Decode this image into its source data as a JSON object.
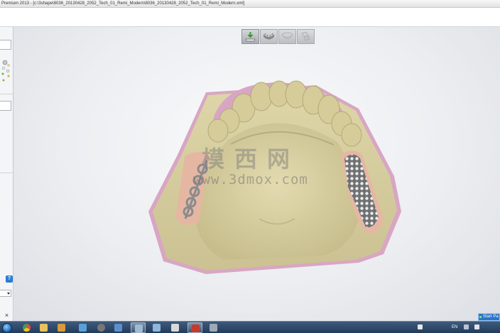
{
  "window": {
    "title": "Premium 2013 - [c:\\3shape\\8036_20130428_2052_Tech_01_Remi_Modern\\8036_20130428_2052_Tech_01_Remi_Modern.xml]"
  },
  "view_toolbar": {
    "buttons": [
      {
        "icon": "model-import-icon",
        "state": "enabled"
      },
      {
        "icon": "maxilla-scan-icon",
        "state": "disabled"
      },
      {
        "icon": "arch-shell-icon",
        "state": "disabled"
      },
      {
        "icon": "bite-stack-icon",
        "state": "disabled"
      }
    ]
  },
  "viewport": {
    "model": "upper-jaw-partial-denture-model",
    "watermark": {
      "chinese": "模西网",
      "url": "www.3dmox.com"
    }
  },
  "left_panel": {
    "badge": "?",
    "close": "×"
  },
  "taskbar": {
    "language": "EN",
    "notification": "Start Pa"
  },
  "colors": {
    "model_plaster": "#d6cd9d",
    "gum_pink": "#d8a6c4",
    "mesh_metal": "#7f7f80",
    "taskbar": "#2c4668",
    "accent": "#2a7cd1"
  }
}
